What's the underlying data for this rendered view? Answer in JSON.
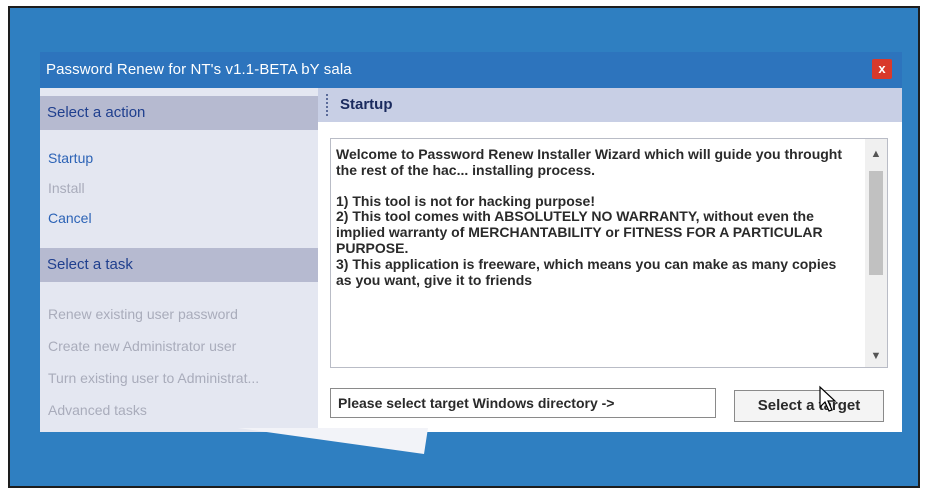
{
  "window": {
    "title": "Password Renew for NT's v1.1-BETA bY sala",
    "close_glyph": "x"
  },
  "sidebar": {
    "action_header": "Select a action",
    "actions": [
      {
        "label": "Startup",
        "state": "active"
      },
      {
        "label": "Install",
        "state": "disabled"
      },
      {
        "label": "Cancel",
        "state": "active"
      }
    ],
    "task_header": "Select a task",
    "tasks": [
      {
        "label": "Renew existing user password"
      },
      {
        "label": "Create new Administrator user"
      },
      {
        "label": "Turn existing user to Administrat..."
      },
      {
        "label": "Advanced tasks"
      }
    ]
  },
  "main": {
    "header": "Startup",
    "welcome": "Welcome to Password Renew Installer Wizard which will guide you throught the rest of the hac... installing process.",
    "points": [
      "1) This tool is not for hacking purpose!",
      "2) This tool comes with ABSOLUTELY NO WARRANTY, without even the implied warranty of MERCHANTABILITY or FITNESS FOR A PARTICULAR PURPOSE.",
      "3) This application is freeware, which means you can make as many copies as you want, give it to friends"
    ],
    "directory_prompt": "Please select target Windows directory ->",
    "target_button": "Select a target"
  },
  "colors": {
    "desktop": "#2f7fc1",
    "titlebar": "#2d74bd",
    "close": "#d9392b",
    "link": "#2c63b6",
    "disabled": "#a9acbb"
  }
}
